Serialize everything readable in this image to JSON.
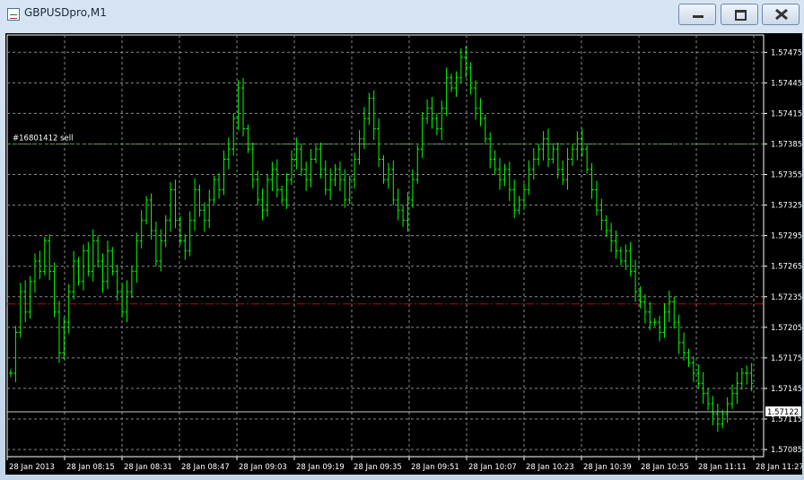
{
  "window": {
    "title": "GBPUSDpro,M1"
  },
  "colors": {
    "candles": "#00ff00",
    "grid": "#8a8a8a",
    "axis": "#ffffff",
    "price_line": "#c8c8c8",
    "order_line": "#cc0000",
    "sell_line": "#4f9a4f"
  },
  "chart": {
    "symbol": "GBPUSDpro",
    "timeframe": "M1",
    "current_price": "1.57122",
    "order_label": "#16801412 sell",
    "order_price": 1.57385,
    "red_line_price": 1.57228
  },
  "chart_data": {
    "type": "bar",
    "y_labels": [
      "1.57475",
      "1.57445",
      "1.57415",
      "1.57385",
      "1.57355",
      "1.57325",
      "1.57295",
      "1.57265",
      "1.57235",
      "1.57205",
      "1.57175",
      "1.57145",
      "1.57115",
      "1.57085"
    ],
    "x_labels": [
      "28 Jan 2013",
      "28 Jan 08:15",
      "28 Jan 08:31",
      "28 Jan 08:47",
      "28 Jan 09:03",
      "28 Jan 09:19",
      "28 Jan 09:35",
      "28 Jan 09:51",
      "28 Jan 10:07",
      "28 Jan 10:23",
      "28 Jan 10:39",
      "28 Jan 10:55",
      "28 Jan 11:11",
      "28 Jan 11:27"
    ],
    "ylim": [
      1.57078,
      1.57492
    ],
    "closes": [
      1.5716,
      1.572,
      1.5724,
      1.5722,
      1.5725,
      1.5727,
      1.5726,
      1.5729,
      1.5726,
      1.5722,
      1.5718,
      1.5721,
      1.5724,
      1.5727,
      1.5725,
      1.5728,
      1.5726,
      1.5729,
      1.5727,
      1.5725,
      1.5728,
      1.5726,
      1.5724,
      1.5722,
      1.5724,
      1.5726,
      1.5729,
      1.5731,
      1.5733,
      1.573,
      1.5727,
      1.5729,
      1.5731,
      1.5734,
      1.5731,
      1.5729,
      1.5728,
      1.5731,
      1.5734,
      1.5732,
      1.5731,
      1.5733,
      1.5735,
      1.5734,
      1.5737,
      1.5738,
      1.5741,
      1.5744,
      1.574,
      1.5738,
      1.5735,
      1.5733,
      1.5732,
      1.5735,
      1.5736,
      1.5734,
      1.5733,
      1.5735,
      1.5737,
      1.5738,
      1.5736,
      1.5735,
      1.5737,
      1.5738,
      1.5736,
      1.5734,
      1.5735,
      1.5736,
      1.5735,
      1.5733,
      1.5735,
      1.5737,
      1.5739,
      1.5741,
      1.5743,
      1.574,
      1.5737,
      1.5735,
      1.5736,
      1.5733,
      1.5732,
      1.5731,
      1.5733,
      1.5735,
      1.5738,
      1.5741,
      1.5742,
      1.5741,
      1.574,
      1.5742,
      1.5745,
      1.5744,
      1.5745,
      1.5747,
      1.5746,
      1.5744,
      1.5742,
      1.5741,
      1.5739,
      1.5737,
      1.5736,
      1.5735,
      1.5736,
      1.5734,
      1.5732,
      1.5733,
      1.5734,
      1.5736,
      1.5737,
      1.5738,
      1.5739,
      1.5737,
      1.5738,
      1.5736,
      1.5735,
      1.5737,
      1.5738,
      1.5739,
      1.5738,
      1.5736,
      1.5734,
      1.5732,
      1.5731,
      1.573,
      1.5729,
      1.5728,
      1.5727,
      1.5728,
      1.5726,
      1.5724,
      1.5723,
      1.5722,
      1.5721,
      1.5721,
      1.572,
      1.5722,
      1.5723,
      1.5721,
      1.5719,
      1.5718,
      1.5717,
      1.5716,
      1.5715,
      1.5714,
      1.5713,
      1.5712,
      1.5711,
      1.5712,
      1.5713,
      1.5714,
      1.5715,
      1.5716,
      1.5716,
      1.5715
    ]
  },
  "icons": {
    "app": "chart-window-icon",
    "minimize": "minimize-icon",
    "maximize": "maximize-icon",
    "close": "close-icon"
  }
}
